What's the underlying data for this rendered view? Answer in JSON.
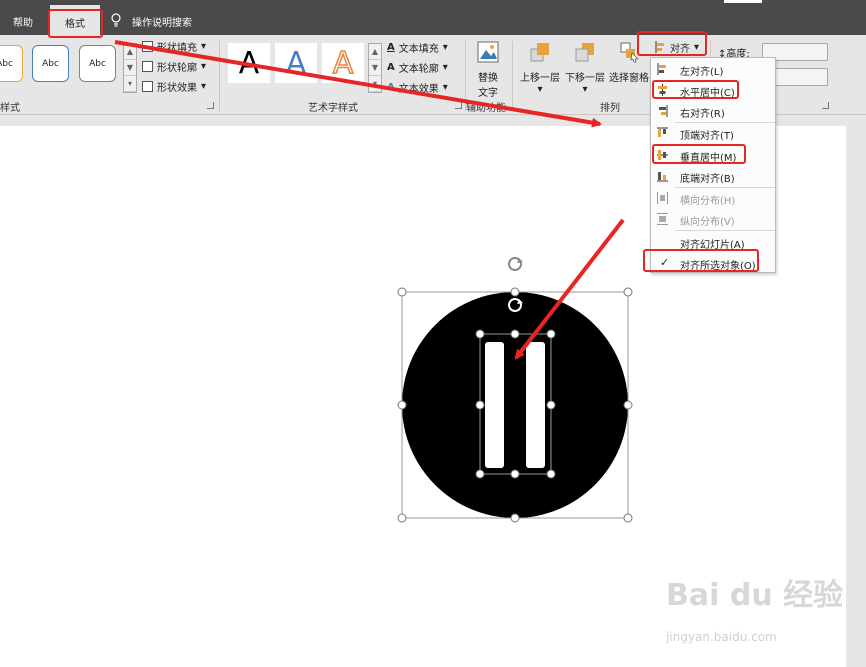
{
  "tabs": {
    "help": "帮助",
    "format": "格式",
    "search": "操作说明搜索"
  },
  "ribbon": {
    "shape_styles": [
      "Abc",
      "Abc",
      "Abc"
    ],
    "shape_fill": "形状填充",
    "shape_outline": "形状轮廓",
    "shape_effects": "形状效果",
    "shape_group_label": "样式",
    "wordart_letters": [
      "A",
      "A",
      "A"
    ],
    "text_fill": "文本填充",
    "text_outline": "文本轮廓",
    "text_effects": "文本效果",
    "wordart_group_label": "艺术字样式",
    "alt_text_line1": "替换",
    "alt_text_line2": "文字",
    "alt_text_group_label": "辅助功能",
    "bring_forward": "上移一层",
    "send_backward": "下移一层",
    "selection_pane": "选择窗格",
    "arrange_group_label": "排列",
    "align_button": "对齐",
    "height_label": "高度:"
  },
  "align_menu": {
    "items": [
      {
        "label": "左对齐(L)",
        "icon": "align-left-icon",
        "enabled": true,
        "checked": false
      },
      {
        "label": "水平居中(C)",
        "icon": "align-center-icon",
        "enabled": true,
        "checked": false
      },
      {
        "label": "右对齐(R)",
        "icon": "align-right-icon",
        "enabled": true,
        "checked": false
      },
      {
        "label": "顶端对齐(T)",
        "icon": "align-top-icon",
        "enabled": true,
        "checked": false
      },
      {
        "label": "垂直居中(M)",
        "icon": "align-middle-icon",
        "enabled": true,
        "checked": false
      },
      {
        "label": "底端对齐(B)",
        "icon": "align-bottom-icon",
        "enabled": true,
        "checked": false
      },
      {
        "label": "横向分布(H)",
        "icon": "distribute-horizontal-icon",
        "enabled": false,
        "checked": false
      },
      {
        "label": "纵向分布(V)",
        "icon": "distribute-vertical-icon",
        "enabled": false,
        "checked": false
      },
      {
        "label": "对齐幻灯片(A)",
        "icon": "",
        "enabled": true,
        "checked": false
      },
      {
        "label": "对齐所选对象(O)",
        "icon": "",
        "enabled": true,
        "checked": true
      }
    ]
  },
  "watermark": {
    "brand": "Bai du 经验",
    "url": "jingyan.baidu.com"
  },
  "colors": {
    "highlight": "#e82424",
    "accent_orange": "#e8a33d",
    "tab_bar": "#4a4a4a",
    "ribbon": "#e6e6e6"
  }
}
